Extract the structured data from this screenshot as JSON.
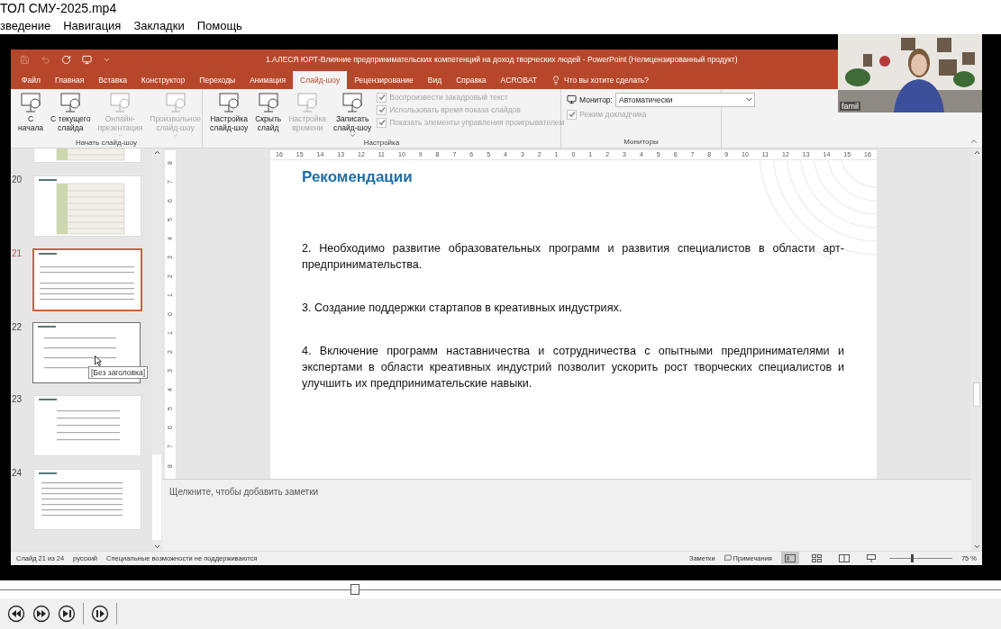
{
  "player": {
    "file_title": "ТОЛ СМУ-2025.mp4",
    "menu": [
      "зведение",
      "Навигация",
      "Закладки",
      "Помощь"
    ],
    "seek": {
      "level": 0.35
    },
    "controls": [
      {
        "kind": "rewind"
      },
      {
        "kind": "forward"
      },
      {
        "kind": "next"
      },
      {
        "kind": "step"
      }
    ]
  },
  "webcam": {
    "label": "famil"
  },
  "powerpoint": {
    "title": "1.АЛЕСЯ ЮРТ-Влияние предпринимательских компетенций на доход творческих людей  -  PowerPoint (Нелицензированный продукт)",
    "tabs": [
      {
        "label": "Файл",
        "selected": false
      },
      {
        "label": "Главная",
        "selected": false
      },
      {
        "label": "Вставка",
        "selected": false
      },
      {
        "label": "Конструктор",
        "selected": false
      },
      {
        "label": "Переходы",
        "selected": false
      },
      {
        "label": "Анимация",
        "selected": false
      },
      {
        "label": "Слайд-шоу",
        "selected": true
      },
      {
        "label": "Рецензирование",
        "selected": false
      },
      {
        "label": "Вид",
        "selected": false
      },
      {
        "label": "Справка",
        "selected": false
      },
      {
        "label": "ACROBAT",
        "selected": false
      }
    ],
    "tell_me": "Что вы хотите сделать?",
    "ribbon": {
      "groups": [
        {
          "label": "Начать слайд-шоу",
          "buttons": [
            {
              "lines": [
                "С",
                "начала"
              ],
              "disabled": false,
              "dropdown": false
            },
            {
              "lines": [
                "С текущего",
                "слайда"
              ],
              "disabled": false,
              "dropdown": false
            },
            {
              "lines": [
                "Онлайн-",
                "презентация"
              ],
              "disabled": true,
              "dropdown": true
            },
            {
              "lines": [
                "Произвольное",
                "слайд-шоу"
              ],
              "disabled": true,
              "dropdown": true
            }
          ]
        },
        {
          "label": "Настройка",
          "buttons": [
            {
              "lines": [
                "Настройка",
                "слайд-шоу"
              ],
              "disabled": false,
              "dropdown": false
            },
            {
              "lines": [
                "Скрыть",
                "слайд"
              ],
              "disabled": false,
              "dropdown": false
            },
            {
              "lines": [
                "Настройка",
                "времени"
              ],
              "disabled": true,
              "dropdown": false
            },
            {
              "lines": [
                "Записать",
                "слайд-шоу"
              ],
              "disabled": false,
              "dropdown": true
            }
          ],
          "checkboxes": [
            {
              "label": "Воспроизвести закадровый текст",
              "checked": true,
              "disabled": true
            },
            {
              "label": "Использовать время показа слайдов",
              "checked": true,
              "disabled": true
            },
            {
              "label": "Показать элементы управления проигрывателем",
              "checked": true,
              "disabled": true
            }
          ]
        },
        {
          "label": "Мониторы",
          "monitor_label": "Монитор:",
          "monitor_value": "Автоматически",
          "checkboxes": [
            {
              "label": "Режим докладчика",
              "checked": true,
              "disabled": true
            }
          ]
        }
      ]
    },
    "slides": [
      {
        "kind": "table",
        "selected": false,
        "hovered": false
      },
      {
        "number": "20",
        "kind": "table",
        "selected": false,
        "hovered": false
      },
      {
        "number": "21",
        "kind": "text",
        "selected": true,
        "hovered": false
      },
      {
        "number": "22",
        "kind": "list",
        "selected": false,
        "hovered": true
      },
      {
        "number": "23",
        "kind": "centered",
        "selected": false,
        "hovered": false
      },
      {
        "number": "24",
        "kind": "references",
        "selected": false,
        "hovered": false
      }
    ],
    "tooltip": "[Без заголовка]",
    "horizontal_ruler": [
      "16",
      "15",
      "14",
      "13",
      "12",
      "11",
      "10",
      "9",
      "8",
      "7",
      "6",
      "5",
      "4",
      "3",
      "2",
      "1",
      "0",
      "1",
      "2",
      "3",
      "4",
      "5",
      "6",
      "7",
      "8",
      "9",
      "10",
      "11",
      "12",
      "13",
      "14",
      "15",
      "16"
    ],
    "vertical_ruler": [
      "8",
      "7",
      "6",
      "5",
      "4",
      "3",
      "2",
      "1",
      "0",
      "1",
      "2",
      "3",
      "4",
      "5",
      "6",
      "7",
      "8"
    ],
    "slide": {
      "title": "Рекомендации",
      "paragraphs": [
        "2. Необходимо развитие образовательных программ и развития специалистов в области арт-предпринимательства.",
        "3. Создание поддержки стартапов в креативных индустриях.",
        "4. Включение программ наставничества и сотрудничества с опытными предпринимателями и экспертами в области креативных индустрий позволит ускорить рост творческих специалистов и улучшить их предпринимательские навыки."
      ]
    },
    "notes_placeholder": "Щелкните, чтобы добавить заметки",
    "status_bar": {
      "slide_info": "Слайд 21 из 24",
      "language": "русский",
      "accessibility": "Специальные возможности не поддерживаются",
      "notes": "Заметки",
      "comments": "Примечания",
      "views": [
        {
          "kind": "normal",
          "selected": true
        },
        {
          "kind": "sorter",
          "selected": false
        },
        {
          "kind": "reading",
          "selected": false
        },
        {
          "kind": "show",
          "selected": false
        }
      ],
      "zoom": {
        "level": 0.35
      },
      "zoom_value": "75 %"
    }
  }
}
